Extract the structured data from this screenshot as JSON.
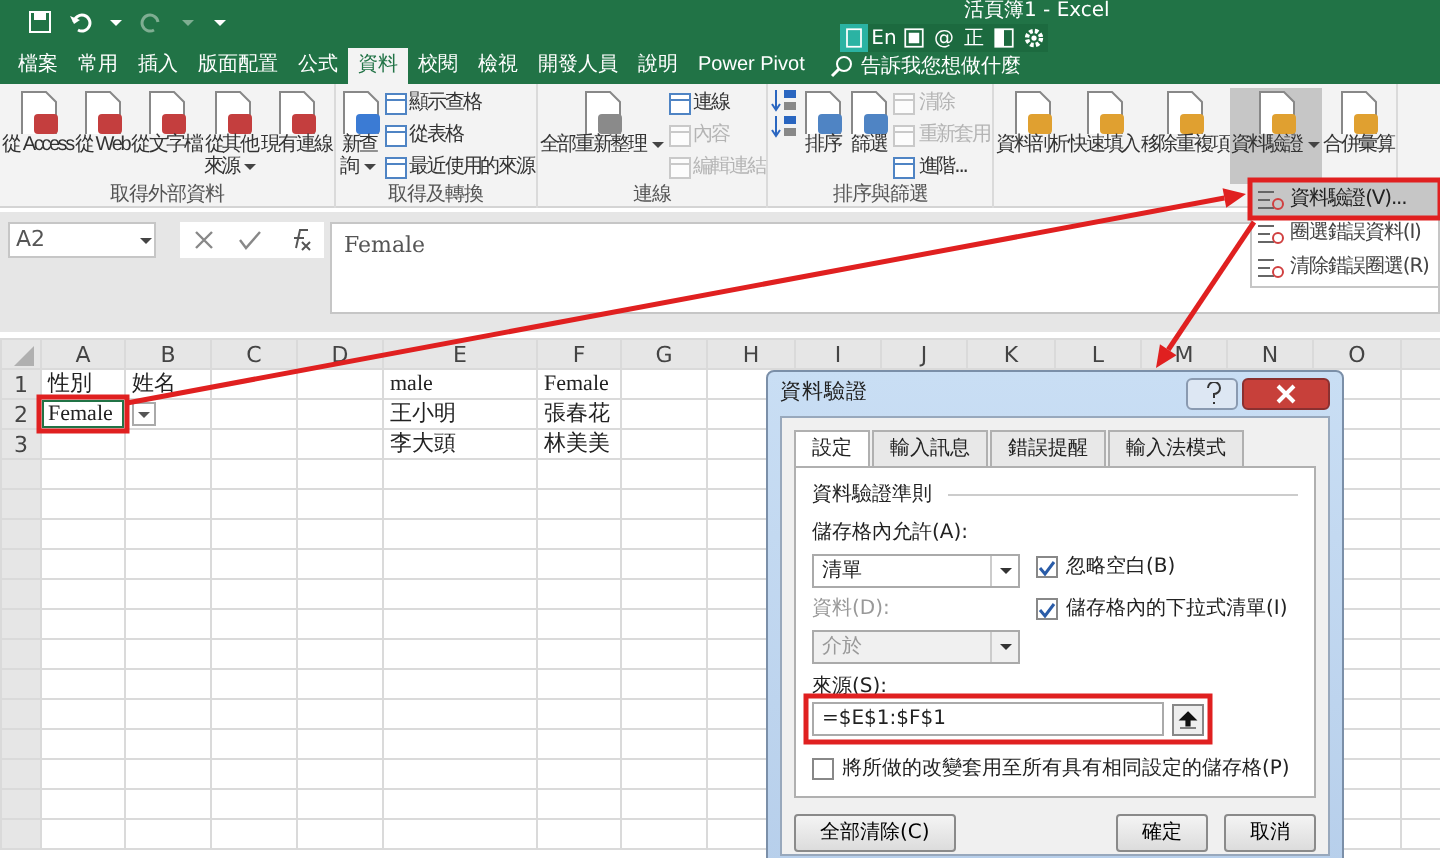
{
  "title_bar": {
    "title": "活頁簿1  -  Excel",
    "ime_labels": [
      "En",
      "@",
      "正"
    ]
  },
  "ribbon_tabs": [
    {
      "label": "檔案",
      "selected": false
    },
    {
      "label": "常用",
      "selected": false
    },
    {
      "label": "插入",
      "selected": false
    },
    {
      "label": "版面配置",
      "selected": false
    },
    {
      "label": "公式",
      "selected": false
    },
    {
      "label": "資料",
      "selected": true
    },
    {
      "label": "校閱",
      "selected": false
    },
    {
      "label": "檢視",
      "selected": false
    },
    {
      "label": "開發人員",
      "selected": false
    },
    {
      "label": "說明",
      "selected": false
    },
    {
      "label": "Power Pivot",
      "selected": false
    }
  ],
  "search": {
    "placeholder": "告訴我您想做什麼"
  },
  "ribbon_groups": [
    {
      "label": "取得外部資料",
      "buttons": [
        {
          "kind": "large",
          "lines": [
            "從 Access"
          ],
          "dropdown": false,
          "disabled": false,
          "pressed": false
        },
        {
          "kind": "large",
          "lines": [
            "從 Web"
          ],
          "dropdown": false,
          "disabled": false,
          "pressed": false
        },
        {
          "kind": "large",
          "lines": [
            "從文字檔"
          ],
          "dropdown": false,
          "disabled": false,
          "pressed": false
        },
        {
          "kind": "large",
          "lines": [
            "從其他",
            "來源"
          ],
          "dropdown": true,
          "disabled": false,
          "pressed": false
        },
        {
          "kind": "large",
          "lines": [
            "現有連線"
          ],
          "dropdown": false,
          "disabled": false,
          "pressed": false
        }
      ]
    },
    {
      "label": "取得及轉換",
      "buttons": [
        {
          "kind": "large",
          "lines": [
            "新查",
            "詢"
          ],
          "dropdown": true,
          "disabled": false,
          "pressed": false
        },
        {
          "kind": "small",
          "lines": [
            "顯示查格"
          ],
          "dropdown": false,
          "disabled": false,
          "pressed": false
        },
        {
          "kind": "small",
          "lines": [
            "從表格"
          ],
          "dropdown": false,
          "disabled": false,
          "pressed": false
        },
        {
          "kind": "small",
          "lines": [
            "最近使用的來源"
          ],
          "dropdown": false,
          "disabled": false,
          "pressed": false
        }
      ]
    },
    {
      "label": "連線",
      "buttons": [
        {
          "kind": "large",
          "lines": [
            "全部重新整理"
          ],
          "dropdown": true,
          "disabled": false,
          "pressed": false
        },
        {
          "kind": "small",
          "lines": [
            "連線"
          ],
          "dropdown": false,
          "disabled": false,
          "pressed": false
        },
        {
          "kind": "small",
          "lines": [
            "內容"
          ],
          "dropdown": false,
          "disabled": true,
          "pressed": false
        },
        {
          "kind": "small",
          "lines": [
            "編輯連結"
          ],
          "dropdown": false,
          "disabled": true,
          "pressed": false
        }
      ]
    },
    {
      "label": "排序與篩選",
      "buttons": [
        {
          "kind": "icon",
          "dropdown": false,
          "disabled": false,
          "pressed": false
        },
        {
          "kind": "icon",
          "dropdown": false,
          "disabled": false,
          "pressed": false
        },
        {
          "kind": "large",
          "lines": [
            "排序"
          ],
          "dropdown": false,
          "disabled": false,
          "pressed": false
        },
        {
          "kind": "large",
          "lines": [
            "篩選"
          ],
          "dropdown": false,
          "disabled": false,
          "pressed": false
        },
        {
          "kind": "small",
          "lines": [
            "清除"
          ],
          "dropdown": false,
          "disabled": true,
          "pressed": false
        },
        {
          "kind": "small",
          "lines": [
            "重新套用"
          ],
          "dropdown": false,
          "disabled": true,
          "pressed": false
        },
        {
          "kind": "small",
          "lines": [
            "進階..."
          ],
          "dropdown": false,
          "disabled": false,
          "pressed": false
        }
      ]
    },
    {
      "buttons": [
        {
          "kind": "large",
          "lines": [
            "資料剖析"
          ],
          "dropdown": false,
          "disabled": false,
          "pressed": false
        },
        {
          "kind": "large",
          "lines": [
            "快速填入"
          ],
          "dropdown": false,
          "disabled": false,
          "pressed": false
        },
        {
          "kind": "large",
          "lines": [
            "移除重複項"
          ],
          "dropdown": false,
          "disabled": false,
          "pressed": false
        },
        {
          "kind": "large",
          "lines": [
            "資料驗證"
          ],
          "dropdown": true,
          "disabled": false,
          "pressed": true
        },
        {
          "kind": "large",
          "lines": [
            "合併彙算"
          ],
          "dropdown": false,
          "disabled": false,
          "pressed": false
        }
      ]
    }
  ],
  "menu": {
    "items": [
      {
        "label": "資料驗證(V)...",
        "selected": true
      },
      {
        "label": "圈選錯誤資料(I)",
        "selected": false
      },
      {
        "label": "清除錯誤圈選(R)",
        "selected": false
      }
    ]
  },
  "formula_bar": {
    "name_box": "A2",
    "formula": "Female"
  },
  "sheet": {
    "columns": [
      "A",
      "B",
      "C",
      "D",
      "E",
      "F",
      "G",
      "H",
      "I",
      "J",
      "K",
      "L",
      "M",
      "N",
      "O"
    ],
    "rows": [
      {
        "header": "1",
        "cells": [
          {
            "text": "性別",
            "selected": false
          },
          {
            "text": "姓名",
            "selected": false
          },
          null,
          null,
          {
            "text": "male",
            "selected": false
          },
          {
            "text": "Female",
            "selected": false
          }
        ]
      },
      {
        "header": "2",
        "cells": [
          {
            "text": "Female",
            "selected": true
          },
          null,
          null,
          null,
          {
            "text": "王小明",
            "selected": false
          },
          {
            "text": "張春花",
            "selected": false
          }
        ]
      },
      {
        "header": "3",
        "cells": [
          null,
          null,
          null,
          null,
          {
            "text": "李大頭",
            "selected": false
          },
          {
            "text": "林美美",
            "selected": false
          }
        ]
      }
    ]
  },
  "dialog": {
    "title": "資料驗證",
    "tabs": [
      {
        "label": "設定",
        "selected": true
      },
      {
        "label": "輸入訊息",
        "selected": false
      },
      {
        "label": "錯誤提醒",
        "selected": false
      },
      {
        "label": "輸入法模式",
        "selected": false
      }
    ],
    "section": "資料驗證準則",
    "allow_label": "儲存格內允許(A):",
    "allow_value": "清單",
    "checkboxes": [
      {
        "label": "忽略空白(B)",
        "checked": true
      },
      {
        "label": "儲存格內的下拉式清單(I)",
        "checked": true
      }
    ],
    "data_label": "資料(D):",
    "data_value": "介於",
    "data_disabled": true,
    "source_label": "來源(S):",
    "source_value": "=$E$1:$F$1",
    "apply_all": {
      "label": "將所做的改變套用至所有具有相同設定的儲存格(P)",
      "checked": false
    },
    "buttons": [
      "全部清除(C)",
      "確定",
      "取消"
    ]
  }
}
